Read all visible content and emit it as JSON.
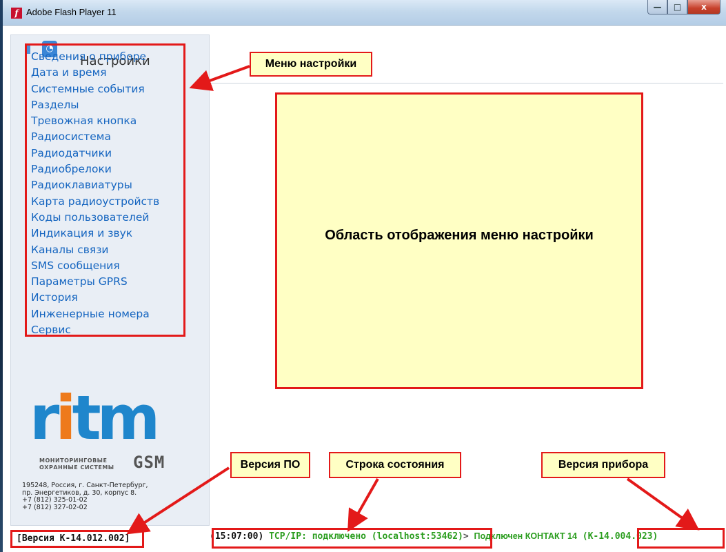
{
  "window": {
    "title": "Adobe Flash Player 11",
    "buttons": {
      "minimize": "—",
      "maximize": "□",
      "close": "x"
    }
  },
  "sidebar": {
    "title": "Настройки",
    "top_icons": [
      "usb-icon",
      "rss-icon"
    ],
    "menu_items": [
      "Сведения о приборе",
      "Дата и время",
      "Системные события",
      "Разделы",
      "Тревожная кнопка",
      "Радиосистема",
      "Радиодатчики",
      "Радиобрелоки",
      "Радиоклавиатуры",
      "Карта радиоустройств",
      "Коды пользователей",
      "Индикация и звук",
      "Каналы связи",
      "SMS сообщения",
      "Параметры GPRS",
      "История",
      "Инженерные номера",
      "Сервис"
    ],
    "logo": {
      "r": "r",
      "i": "i",
      "t": "t",
      "m": "m",
      "subtitle_line1": "МОНИТОРИНГОВЫЕ",
      "subtitle_line2": "ОХРАННЫЕ СИСТЕМЫ",
      "gsm": "GSM"
    },
    "address": [
      "195248, Россия, г. Санкт-Петербург,",
      "пр. Энергетиков, д. 30, корпус 8.",
      "+7 (812) 325-01-02",
      "+7 (812) 327-02-02"
    ],
    "sw_version": "[Версия К-14.012.002]"
  },
  "main": {
    "display_text": "Область отображения меню настройки"
  },
  "callouts": {
    "menu_settings": "Меню настройки",
    "sw_version": "Версия ПО",
    "status_line": "Строка состояния",
    "device_version": "Версия прибора"
  },
  "status_bar": {
    "time": "(15:07:00)",
    "tcp": "TCP/IP: подключено (localhost:53462)",
    "separator": ">",
    "connected": "Подключен КОНТАКТ 14",
    "device_version": "(К-14.004.023)"
  },
  "colors": {
    "accent_red": "#e31919",
    "link_blue": "#1565c0",
    "status_green": "#2a9d1e",
    "callout_fill": "#ffffc4",
    "logo_blue": "#1f86cc",
    "logo_orange": "#ee7a1b"
  }
}
